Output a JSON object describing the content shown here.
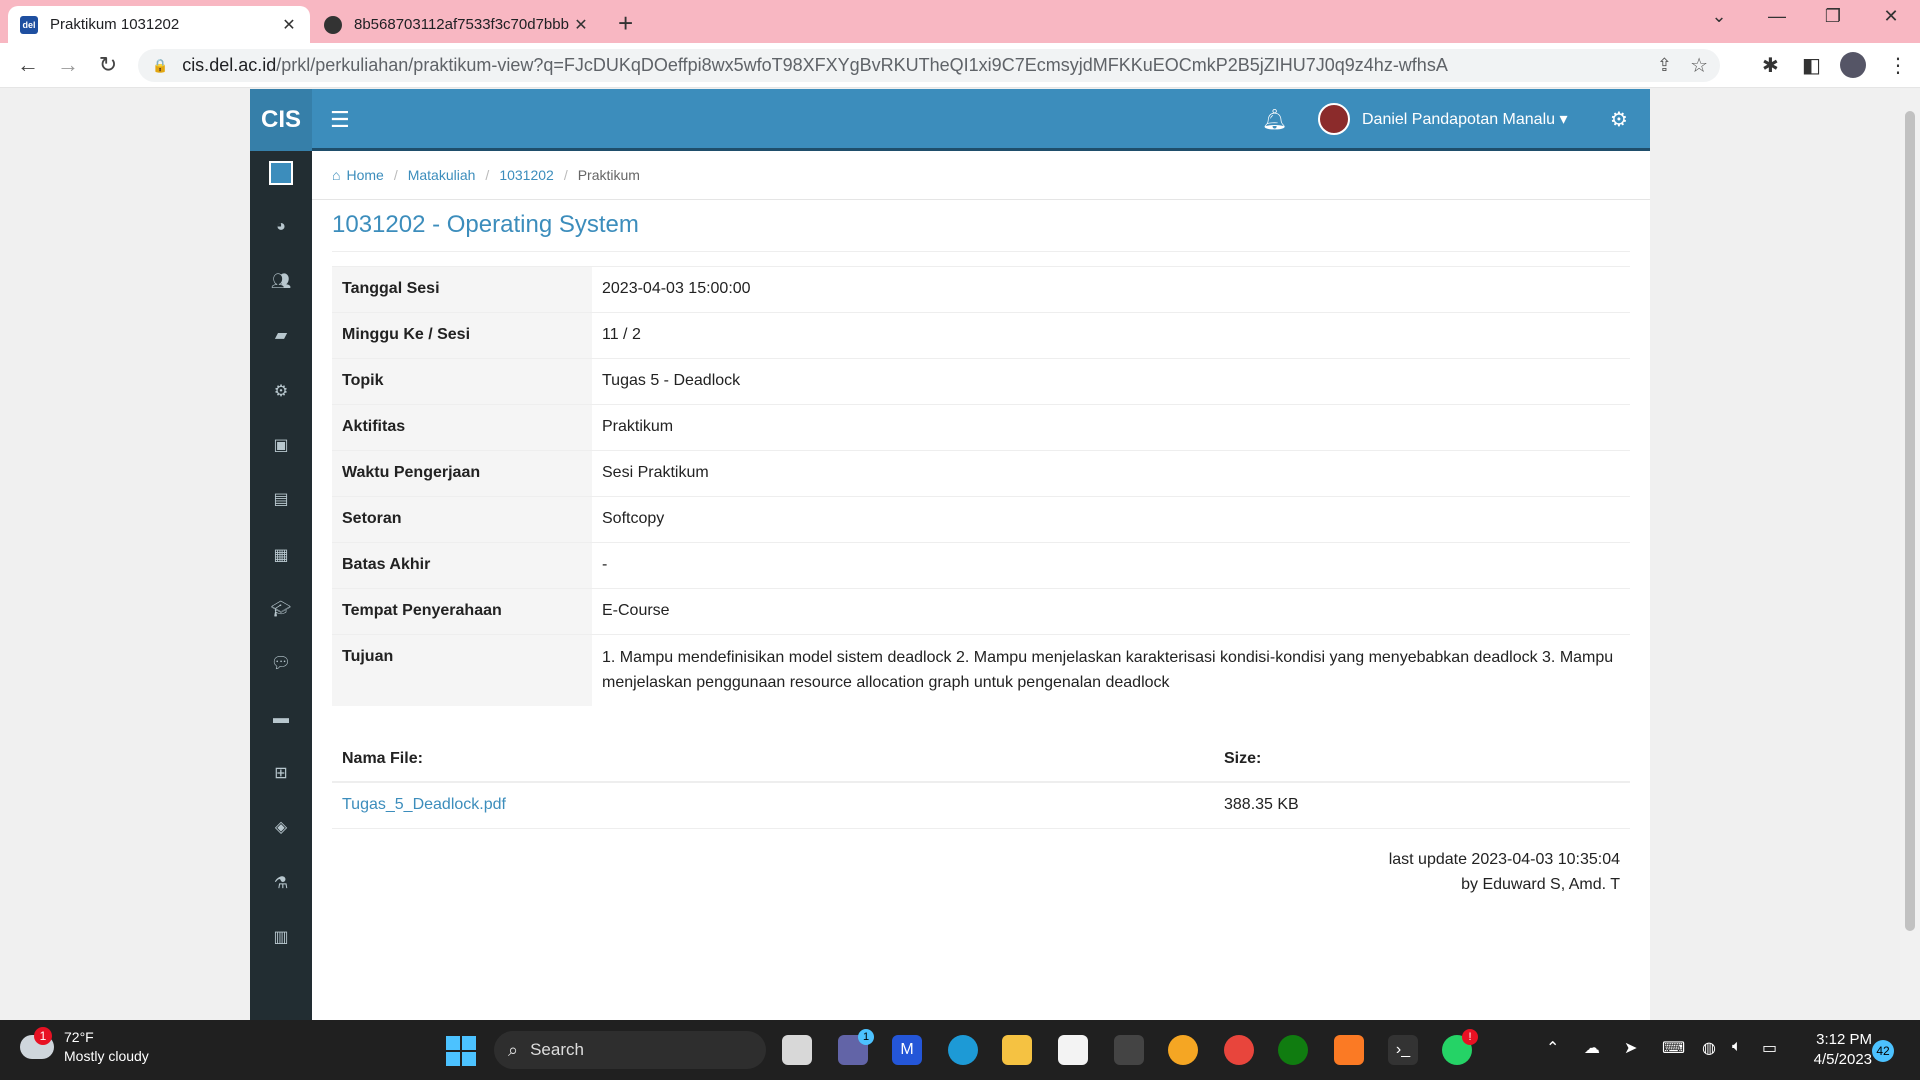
{
  "browser": {
    "tabs": [
      {
        "title": "Praktikum 1031202",
        "favicon": "del-favicon"
      },
      {
        "title": "8b568703112af7533f3c70d7bbb",
        "favicon": "globe-icon"
      }
    ],
    "url_host": "cis.del.ac.id",
    "url_path": "/prkl/perkuliahan/praktikum-view?q=FJcDUKqDOeffpi8wx5wfoT98XFXYgBvRKUTheQI1xi9C7EcmsyjdMFKKuEOCmkP2B5jZIHU7J0q9z4hz-wfhsA"
  },
  "app": {
    "logo": "CIS",
    "user_name": "Daniel Pandapotan Manalu",
    "accent_color": "#3c8dbc",
    "sidebar_icons": [
      "dashboard-icon",
      "users-icon",
      "book-icon",
      "cogs-icon",
      "money-icon",
      "file-icon",
      "newspaper-icon",
      "graduation-cap-icon",
      "comments-icon",
      "archive-icon",
      "plus-square-icon",
      "tag-icon",
      "flask-icon",
      "bar-chart-icon"
    ]
  },
  "breadcrumb": {
    "home": "Home",
    "matakuliah": "Matakuliah",
    "code": "1031202",
    "current": "Praktikum"
  },
  "page": {
    "title": "1031202 - Operating System"
  },
  "details": [
    {
      "label": "Tanggal Sesi",
      "value": "2023-04-03 15:00:00"
    },
    {
      "label": "Minggu Ke / Sesi",
      "value": "11 / 2"
    },
    {
      "label": "Topik",
      "value": "Tugas 5 - Deadlock"
    },
    {
      "label": "Aktifitas",
      "value": "Praktikum"
    },
    {
      "label": "Waktu Pengerjaan",
      "value": "Sesi Praktikum"
    },
    {
      "label": "Setoran",
      "value": "Softcopy"
    },
    {
      "label": "Batas Akhir",
      "value": "-"
    },
    {
      "label": "Tempat Penyerahaan",
      "value": "E-Course"
    },
    {
      "label": "Tujuan",
      "value": "1. Mampu mendefinisikan model sistem deadlock 2. Mampu menjelaskan karakterisasi kondisi-kondisi yang menyebabkan deadlock 3. Mampu menjelaskan penggunaan resource allocation graph untuk pengenalan deadlock"
    }
  ],
  "files": {
    "col_name": "Nama File:",
    "col_size": "Size:",
    "rows": [
      {
        "name": "Tugas_5_Deadlock.pdf",
        "size": "388.35 KB"
      }
    ]
  },
  "last_update": {
    "line1": "last update 2023-04-03 10:35:04",
    "line2": "by Eduward S, Amd. T"
  },
  "taskbar": {
    "weather_badge": "1",
    "temperature": "72°F",
    "condition": "Mostly cloudy",
    "search_placeholder": "Search",
    "teams_badge": "1",
    "whatsapp_badge": "!",
    "time": "3:12 PM",
    "date": "4/5/2023",
    "notifications": "42"
  }
}
